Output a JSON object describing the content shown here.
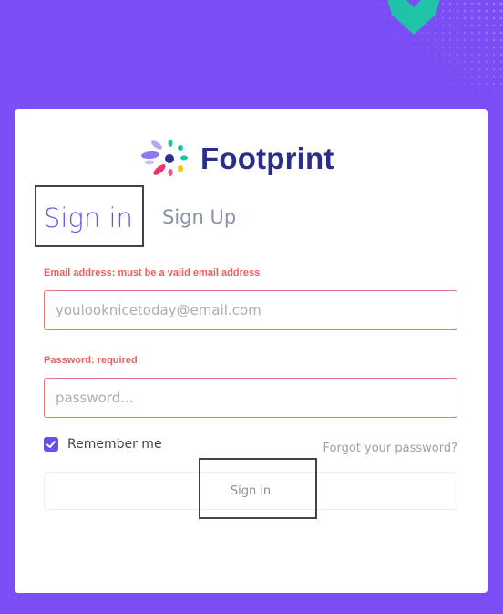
{
  "brand": {
    "name": "Footprint",
    "text_color": "#2a2e8a",
    "logo_icon": "footprint-flower-icon"
  },
  "colors": {
    "background": "#7a4df5",
    "accent": "#6b4fe8",
    "error": "#e8625e",
    "decor_hex": "#1fc3a7"
  },
  "tabs": {
    "signin_label": "Sign in",
    "signup_label": "Sign Up",
    "active": "signin"
  },
  "form": {
    "email": {
      "error_label": "Email address: must be a valid email address",
      "placeholder": "youlooknicetoday@email.com",
      "value": ""
    },
    "password": {
      "error_label": "Password: required",
      "placeholder": "password...",
      "value": ""
    },
    "remember": {
      "label": "Remember me",
      "checked": true
    },
    "forgot_label": "Forgot your password?",
    "submit_label": "Sign in"
  }
}
